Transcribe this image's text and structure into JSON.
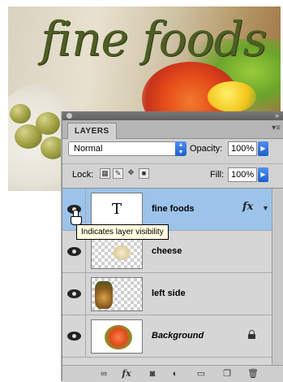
{
  "canvas": {
    "title_text": "fine foods"
  },
  "panel": {
    "tab_label": "LAYERS",
    "menu_icon": "panel-menu-icon",
    "collapse_icon": "collapse-arrows-icon"
  },
  "blend": {
    "mode": "Normal",
    "opacity_label": "Opacity:",
    "opacity_value": "100%"
  },
  "lock": {
    "label": "Lock:",
    "fill_label": "Fill:",
    "fill_value": "100%",
    "icons": [
      "lock-transparent-pixels-icon",
      "lock-image-pixels-icon",
      "lock-position-icon",
      "lock-all-icon"
    ]
  },
  "layers": [
    {
      "name": "fine foods",
      "selected": true,
      "thumb": "type-layer",
      "thumb_glyph": "T",
      "has_fx": true
    },
    {
      "name": "cheese",
      "selected": false,
      "thumb": "transparent"
    },
    {
      "name": "left side",
      "selected": false,
      "thumb": "transparent"
    },
    {
      "name": "Background",
      "selected": false,
      "thumb": "image",
      "locked": true,
      "italic": true
    }
  ],
  "fx_label": "fx",
  "tooltip": "Indicates layer visibility",
  "bottom_bar": {
    "icons": [
      "link-layers-icon",
      "layer-style-fx-icon",
      "add-mask-icon",
      "adjustment-layer-icon",
      "new-group-folder-icon",
      "new-layer-icon",
      "delete-trash-icon"
    ],
    "fx_label": "fx"
  }
}
